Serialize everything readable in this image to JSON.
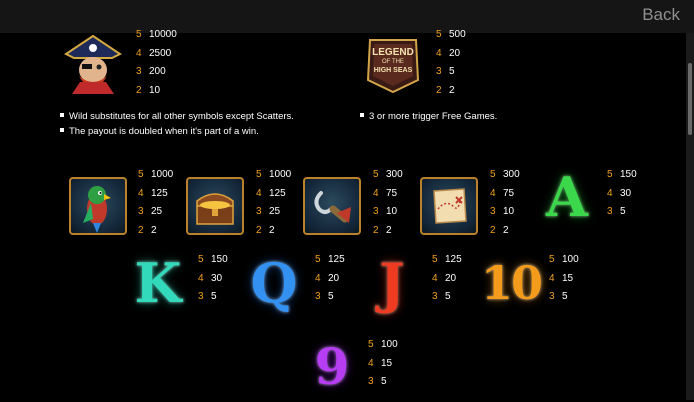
{
  "header": {
    "back_label": "Back"
  },
  "top_symbols": [
    {
      "id": "pirate",
      "icon": "pirate-captain-icon",
      "pays": [
        {
          "n": "5",
          "v": "10000"
        },
        {
          "n": "4",
          "v": "2500"
        },
        {
          "n": "3",
          "v": "200"
        },
        {
          "n": "2",
          "v": "10"
        }
      ]
    },
    {
      "id": "legend",
      "icon": "legend-of-the-high-seas-logo-icon",
      "logo_text": [
        "LEGEND",
        "OF THE",
        "HIGH SEAS"
      ],
      "pays": [
        {
          "n": "5",
          "v": "500"
        },
        {
          "n": "4",
          "v": "20"
        },
        {
          "n": "3",
          "v": "5"
        },
        {
          "n": "2",
          "v": "2"
        }
      ]
    }
  ],
  "notes": {
    "wild": [
      "Wild substitutes for all other symbols except Scatters.",
      "The payout is doubled when it's part of a win."
    ],
    "scatter": [
      "3 or more trigger Free Games."
    ]
  },
  "row1": [
    {
      "id": "parrot",
      "icon": "parrot-icon",
      "pays": [
        {
          "n": "5",
          "v": "1000"
        },
        {
          "n": "4",
          "v": "125"
        },
        {
          "n": "3",
          "v": "25"
        },
        {
          "n": "2",
          "v": "2"
        }
      ]
    },
    {
      "id": "chest",
      "icon": "treasure-chest-icon",
      "pays": [
        {
          "n": "5",
          "v": "1000"
        },
        {
          "n": "4",
          "v": "125"
        },
        {
          "n": "3",
          "v": "25"
        },
        {
          "n": "2",
          "v": "2"
        }
      ]
    },
    {
      "id": "hook",
      "icon": "pirate-hook-icon",
      "pays": [
        {
          "n": "5",
          "v": "300"
        },
        {
          "n": "4",
          "v": "75"
        },
        {
          "n": "3",
          "v": "10"
        },
        {
          "n": "2",
          "v": "2"
        }
      ]
    },
    {
      "id": "map",
      "icon": "treasure-map-icon",
      "pays": [
        {
          "n": "5",
          "v": "300"
        },
        {
          "n": "4",
          "v": "75"
        },
        {
          "n": "3",
          "v": "10"
        },
        {
          "n": "2",
          "v": "2"
        }
      ]
    },
    {
      "id": "A",
      "icon": "letter-a-icon",
      "letter": "A",
      "color": "#39d04a",
      "pays": [
        {
          "n": "5",
          "v": "150"
        },
        {
          "n": "4",
          "v": "30"
        },
        {
          "n": "3",
          "v": "5"
        }
      ]
    }
  ],
  "row2": [
    {
      "id": "K",
      "icon": "letter-k-icon",
      "letter": "K",
      "color": "#2fd6b8",
      "pays": [
        {
          "n": "5",
          "v": "150"
        },
        {
          "n": "4",
          "v": "30"
        },
        {
          "n": "3",
          "v": "5"
        }
      ]
    },
    {
      "id": "Q",
      "icon": "letter-q-icon",
      "letter": "Q",
      "color": "#2e8ff0",
      "pays": [
        {
          "n": "5",
          "v": "125"
        },
        {
          "n": "4",
          "v": "20"
        },
        {
          "n": "3",
          "v": "5"
        }
      ]
    },
    {
      "id": "J",
      "icon": "letter-j-icon",
      "letter": "J",
      "color": "#ee3a22",
      "pays": [
        {
          "n": "5",
          "v": "125"
        },
        {
          "n": "4",
          "v": "20"
        },
        {
          "n": "3",
          "v": "5"
        }
      ]
    },
    {
      "id": "10",
      "icon": "number-ten-icon",
      "letter": "10",
      "color": "#f39a1a",
      "pays": [
        {
          "n": "5",
          "v": "100"
        },
        {
          "n": "4",
          "v": "15"
        },
        {
          "n": "3",
          "v": "5"
        }
      ]
    }
  ],
  "row3": [
    {
      "id": "9",
      "icon": "number-nine-icon",
      "letter": "9",
      "color": "#b43cf0",
      "pays": [
        {
          "n": "5",
          "v": "100"
        },
        {
          "n": "4",
          "v": "15"
        },
        {
          "n": "3",
          "v": "5"
        }
      ]
    }
  ]
}
